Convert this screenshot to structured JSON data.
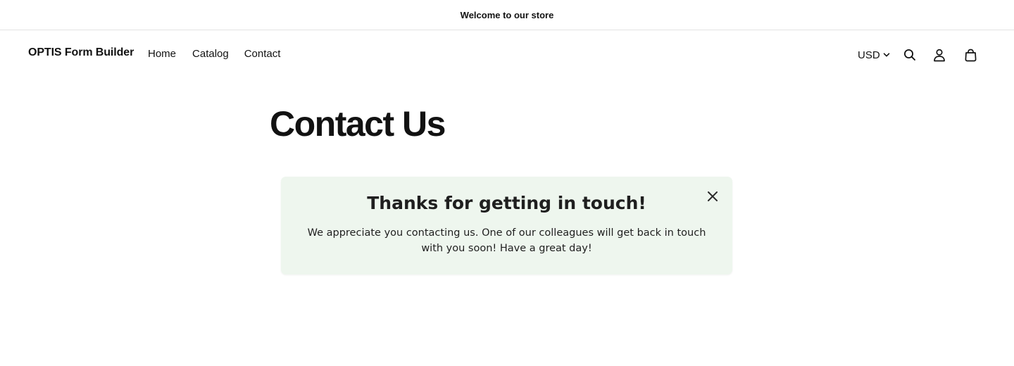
{
  "announcement": {
    "text": "Welcome to our store"
  },
  "header": {
    "logo": "OPTIS Form Builder",
    "nav": [
      {
        "label": "Home"
      },
      {
        "label": "Catalog"
      },
      {
        "label": "Contact"
      }
    ],
    "currency": "USD",
    "icons": [
      "chevron-down-icon",
      "search-icon",
      "account-icon",
      "cart-icon"
    ]
  },
  "main": {
    "title": "Contact Us",
    "success": {
      "title": "Thanks for getting in touch!",
      "message": "We appreciate you contacting us. One of our colleagues will get back in touch with you soon! Have a great day!",
      "close_icon": "close-icon"
    }
  },
  "colors": {
    "text": "#121212",
    "success_background": "#eef6ee",
    "border": "#e3e3e3"
  }
}
